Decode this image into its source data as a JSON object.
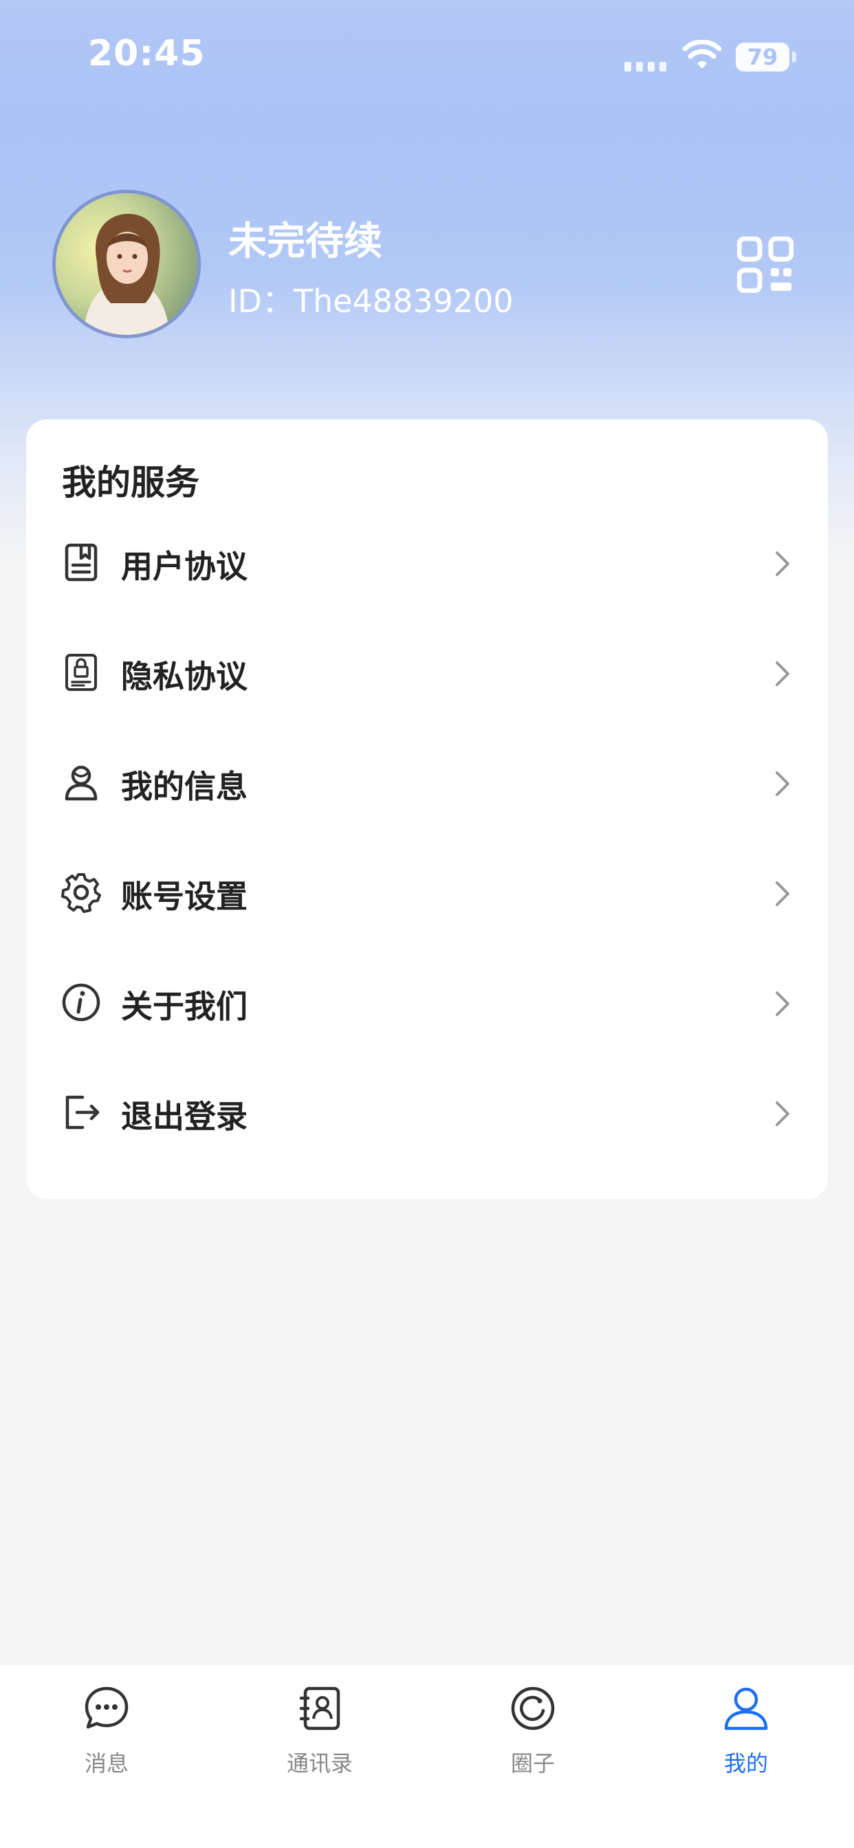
{
  "status_bar": {
    "time": "20:45",
    "battery": "79",
    "icons": [
      "signal-icon",
      "wifi-icon",
      "battery-icon"
    ]
  },
  "profile": {
    "name": "未完待续",
    "id_text": "ID：The48839200",
    "avatar_icon": "avatar-icon",
    "qr_icon": "qr-code-icon"
  },
  "services": {
    "title": "我的服务",
    "items": [
      {
        "label": "用户协议",
        "icon": "document-icon"
      },
      {
        "label": "隐私协议",
        "icon": "privacy-lock-icon"
      },
      {
        "label": "我的信息",
        "icon": "user-info-icon"
      },
      {
        "label": "账号设置",
        "icon": "gear-icon"
      },
      {
        "label": "关于我们",
        "icon": "info-icon"
      },
      {
        "label": "退出登录",
        "icon": "logout-icon"
      }
    ]
  },
  "tabbar": {
    "active_color": "#1d6ff2",
    "inactive_color": "#888888",
    "tabs": [
      {
        "label": "消息",
        "icon": "chat-bubble-icon",
        "active": false
      },
      {
        "label": "通讯录",
        "icon": "contacts-icon",
        "active": false
      },
      {
        "label": "圈子",
        "icon": "circle-icon",
        "active": false
      },
      {
        "label": "我的",
        "icon": "person-icon",
        "active": true
      }
    ]
  },
  "colors": {
    "header_gradient_top": "#b4c8f7",
    "header_gradient_mid": "#aac2f6",
    "page_background": "#f5f5f5",
    "card_background": "#ffffff"
  }
}
